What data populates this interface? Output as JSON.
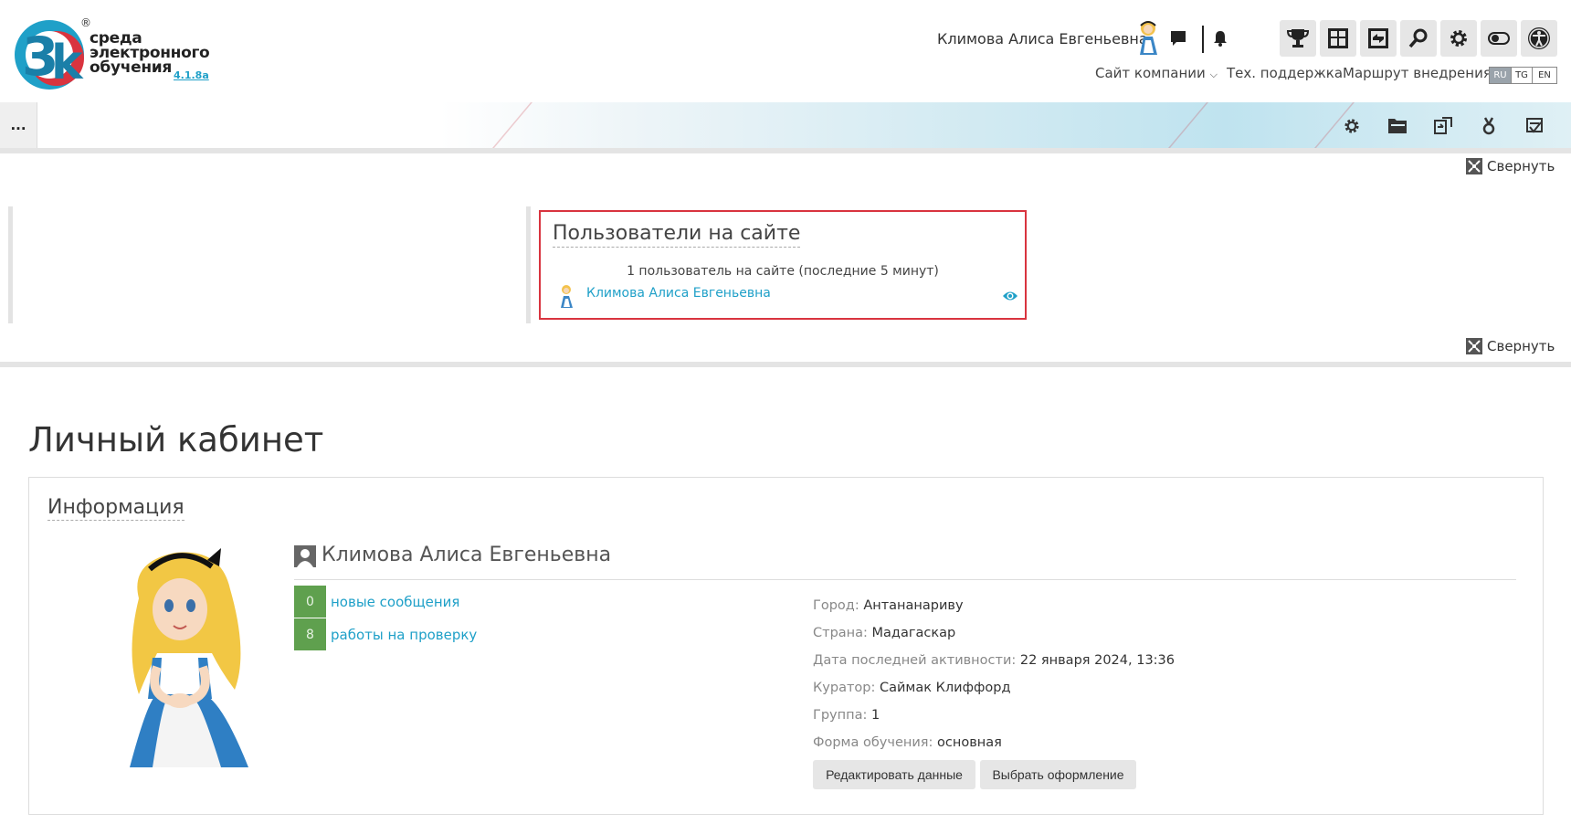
{
  "header": {
    "logo_text": [
      "среда",
      "электронного",
      "обучения"
    ],
    "logo_version": "4.1.8a",
    "logo_reg": "®",
    "user_name": "Климова Алиса Евгеньевна",
    "icons": [
      "chat-icon",
      "bell-icon"
    ],
    "tools": [
      "trophy-icon",
      "dashboard-icon",
      "switch-icon",
      "search-icon",
      "gear-icon",
      "toggle-icon",
      "accessibility-icon"
    ],
    "nav": {
      "company_site": "Сайт компании",
      "support": "Тех. поддержка",
      "route": "Маршрут внедрения"
    },
    "languages": [
      "RU",
      "TG",
      "EN"
    ],
    "active_language": "RU"
  },
  "navbar": {
    "more_label": "...",
    "icons": [
      "gear-icon",
      "folder-icon",
      "switch-icon",
      "certificate-icon",
      "grade-icon"
    ]
  },
  "collapse_label": "Свернуть",
  "online_block": {
    "title": "Пользователи на сайте",
    "count_text": "1 пользователь на сайте (последние 5 минут)",
    "user_name": "Климова Алиса Евгеньевна"
  },
  "page": {
    "title": "Личный кабинет",
    "info": {
      "title": "Информация",
      "full_name": "Климова Алиса Евгеньевна",
      "stats": [
        {
          "count": "0",
          "label": "новые сообщения"
        },
        {
          "count": "8",
          "label": "работы на проверку"
        }
      ],
      "details": [
        {
          "label": "Город:",
          "value": "Антананариву"
        },
        {
          "label": "Страна:",
          "value": "Мадагаскар"
        },
        {
          "label": "Дата последней активности:",
          "value": "22 января 2024, 13:36"
        },
        {
          "label": "Куратор:",
          "value": "Саймак Клиффорд"
        },
        {
          "label": "Группа:",
          "value": "1"
        },
        {
          "label": "Форма обучения:",
          "value": "основная"
        }
      ],
      "buttons": {
        "edit": "Редактировать данные",
        "theme": "Выбрать оформление"
      }
    }
  },
  "colors": {
    "link": "#1fa0c8",
    "badge": "#5fa04e",
    "highlight_border": "#d9343f"
  }
}
